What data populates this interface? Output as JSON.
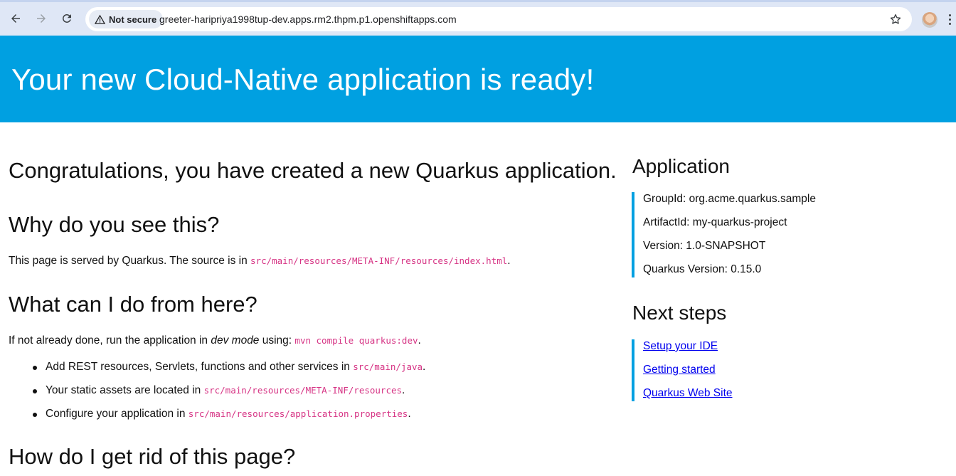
{
  "browser": {
    "security_label": "Not secure",
    "url": "greeter-haripriya1998tup-dev.apps.rm2.thpm.p1.openshiftapps.com",
    "icons": [
      "back-arrow-icon",
      "forward-arrow-icon",
      "reload-icon",
      "warning-triangle-icon",
      "star-icon",
      "profile-avatar",
      "kebab-menu-icon"
    ]
  },
  "colors": {
    "banner": "#00a0e1",
    "code": "#d63384",
    "link": "#0000ee"
  },
  "banner": {
    "title": "Your new Cloud-Native application is ready!"
  },
  "main": {
    "congrats": "Congratulations, you have created a new Quarkus application.",
    "why_heading": "Why do you see this?",
    "why_text_before": "This page is served by Quarkus. The source is in ",
    "why_code": "src/main/resources/META-INF/resources/index.html",
    "why_text_after": ".",
    "what_heading": "What can I do from here?",
    "dev_text_before": "If not already done, run the application in ",
    "dev_em": "dev mode",
    "dev_text_mid": " using: ",
    "dev_code": "mvn compile quarkus:dev",
    "dev_text_after": ".",
    "bullets": [
      {
        "text": "Add REST resources, Servlets, functions and other services in ",
        "code": "src/main/java",
        "after": "."
      },
      {
        "text": "Your static assets are located in ",
        "code": "src/main/resources/META-INF/resources",
        "after": "."
      },
      {
        "text": "Configure your application in ",
        "code": "src/main/resources/application.properties",
        "after": "."
      }
    ],
    "rid_heading": "How do I get rid of this page?"
  },
  "sidebar": {
    "application_heading": "Application",
    "application_items": [
      "GroupId: org.acme.quarkus.sample",
      "ArtifactId: my-quarkus-project",
      "Version: 1.0-SNAPSHOT",
      "Quarkus Version: 0.15.0"
    ],
    "next_heading": "Next steps",
    "next_links": [
      "Setup your IDE",
      "Getting started",
      "Quarkus Web Site"
    ]
  }
}
